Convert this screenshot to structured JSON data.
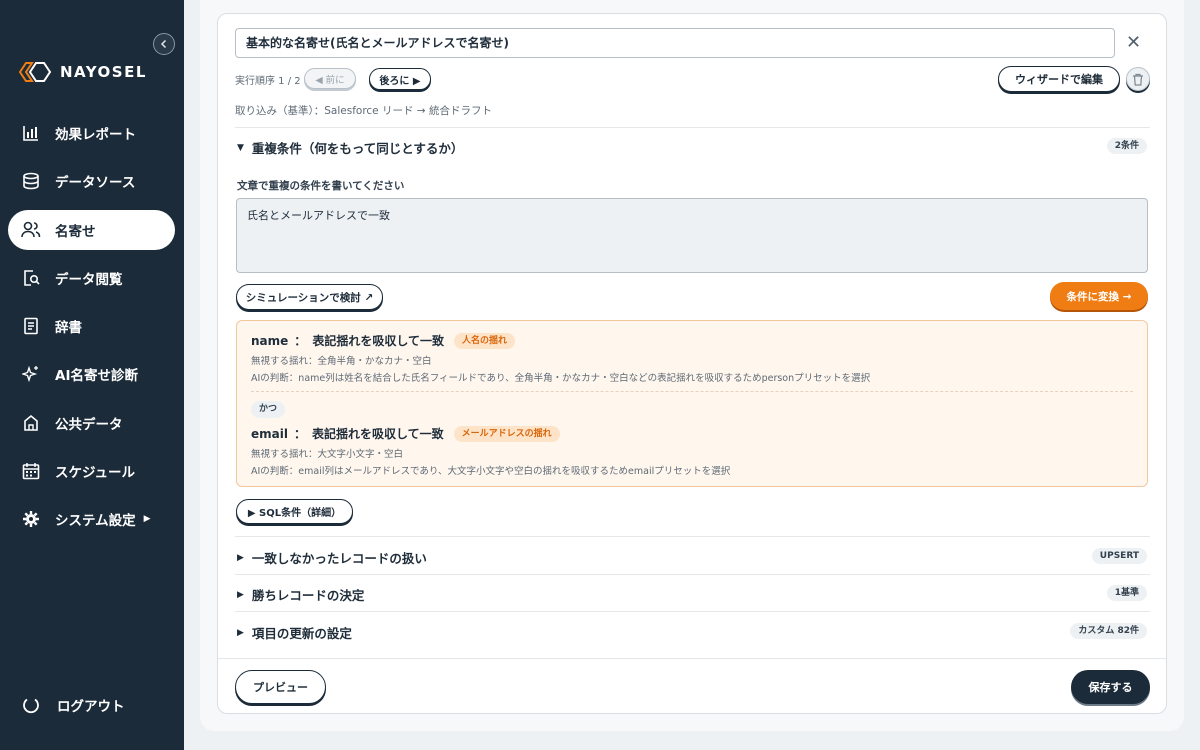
{
  "sidebar": {
    "brand": "NAYOSEL",
    "items": [
      {
        "label": "効果レポート",
        "icon": "bar-chart-icon"
      },
      {
        "label": "データソース",
        "icon": "database-icon"
      },
      {
        "label": "名寄せ",
        "icon": "users-icon"
      },
      {
        "label": "データ閲覧",
        "icon": "search-doc-icon"
      },
      {
        "label": "辞書",
        "icon": "book-icon"
      },
      {
        "label": "AI名寄せ診断",
        "icon": "sparkle-icon"
      },
      {
        "label": "公共データ",
        "icon": "building-icon"
      },
      {
        "label": "スケジュール",
        "icon": "calendar-icon"
      },
      {
        "label": "システム設定",
        "icon": "gear-icon"
      }
    ],
    "active_index": 2,
    "logout": "ログアウト"
  },
  "editor": {
    "title_value": "基本的な名寄せ(氏名とメールアドレスで名寄せ)",
    "order_label": "実行順序 1 / 2",
    "prev_label": "◀ 前に",
    "next_label": "後ろに ▶",
    "wizard_label": "ウィザードで編集",
    "import_line": "取り込み（基準）：Salesforce リード → 統合ドラフト"
  },
  "duplicate_section": {
    "title": "重複条件（何をもって同じとするか）",
    "badge": "2条件",
    "field_label": "文章で重複の条件を書いてください",
    "textarea_value": "氏名とメールアドレスで一致",
    "simulate_label": "シミュレーションで検討 ↗",
    "convert_label": "条件に変換 →",
    "conditions": [
      {
        "field": "name",
        "sep": "：",
        "rule": "表記揺れを吸収して一致",
        "tag": "人名の揺れ",
        "ignore": "無視する揺れ：全角半角・かなカナ・空白",
        "ai": "AIの判断：name列は姓名を結合した氏名フィールドであり、全角半角・かなカナ・空白などの表記揺れを吸収するためpersonプリセットを選択"
      },
      {
        "field": "email",
        "sep": "：",
        "rule": "表記揺れを吸収して一致",
        "tag": "メールアドレスの揺れ",
        "ignore": "無視する揺れ：大文字小文字・空白",
        "ai": "AIの判断：email列はメールアドレスであり、大文字小文字や空白の揺れを吸収するためemailプリセットを選択"
      }
    ],
    "and_label": "かつ",
    "sql_label": "▶ SQL条件（詳細）"
  },
  "sections": [
    {
      "title": "一致しなかったレコードの扱い",
      "badge": "UPSERT"
    },
    {
      "title": "勝ちレコードの決定",
      "badge": "1基準"
    },
    {
      "title": "項目の更新の設定",
      "badge": "カスタム 82件"
    }
  ],
  "footer": {
    "preview_label": "プレビュー",
    "save_label": "保存する"
  },
  "colors": {
    "sidebar_bg": "#1c2b39",
    "accent_orange": "#f07d14",
    "primary_dark": "#1c2b39"
  }
}
